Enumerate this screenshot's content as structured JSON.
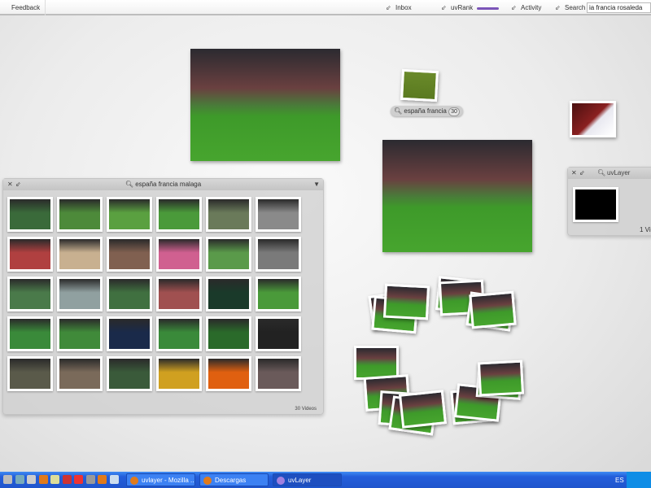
{
  "topbar": {
    "feedback": "Feedback",
    "inbox": "Inbox",
    "uvrank": "uvRank",
    "activity": "Activity",
    "search_label": "Search",
    "search_value": "ia francia rosaleda"
  },
  "main_panel": {
    "title": "españa francia malaga",
    "count": "30 Videos"
  },
  "tag": {
    "label": "españa francia",
    "count": "30"
  },
  "uv_panel": {
    "title": "uvLayer",
    "count": "1 Vi"
  },
  "thumb_colors": [
    "#3a6a3a",
    "#4d8a3a",
    "#5aa040",
    "#4a9a3a",
    "#6a7a5a",
    "#8a8a8a",
    "#b04040",
    "#c8b090",
    "#806050",
    "#d06090",
    "#5a9a4a",
    "#7a7a7a",
    "#4a7a4a",
    "#90a0a0",
    "#407040",
    "#a05050",
    "#1a3a2a",
    "#4a9a3a",
    "#3a8a3a",
    "#408a3a",
    "#1a2a4a",
    "#3a8a3a",
    "#2a6a2a",
    "#222222",
    "#5a5a4a",
    "#7a6a5a",
    "#3a5a3a",
    "#d0a020",
    "#e06010",
    "#6a5a5a"
  ],
  "accent": "#7b55b8",
  "taskbar": {
    "tasks": [
      "uvlayer - Mozilla ...",
      "Descargas",
      "uvLayer"
    ],
    "lang": "ES"
  }
}
